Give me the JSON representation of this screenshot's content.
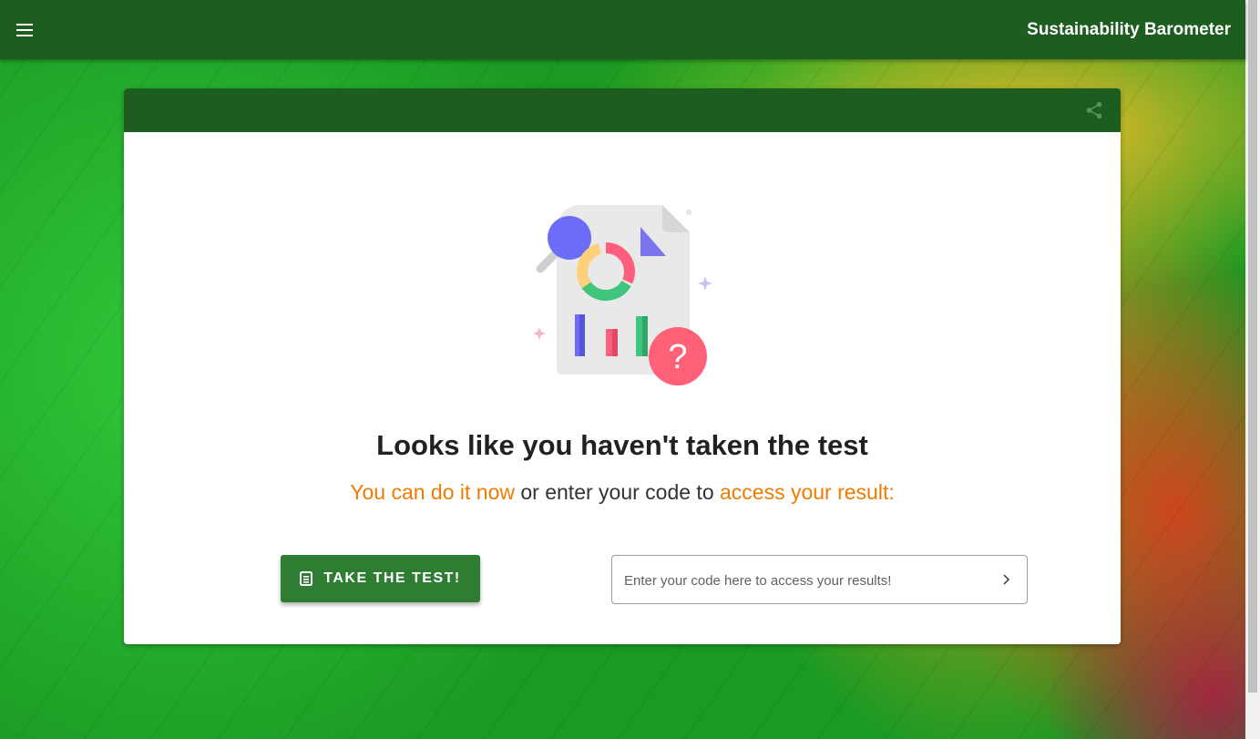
{
  "app": {
    "title": "Sustainability Barometer"
  },
  "icons": {
    "menu": "menu-icon",
    "share": "share-icon",
    "document": "document-icon",
    "chevron": "chevron-right-icon",
    "illustration": "report-question-illustration"
  },
  "main": {
    "headline": "Looks like you haven't taken the test",
    "subline": {
      "part1": "You can do it now",
      "part2": " or enter your code to ",
      "part3": "access your result:"
    },
    "take_test_label": "TAKE THE TEST!",
    "code_input": {
      "value": "",
      "placeholder": "Enter your code here to access your results!"
    }
  },
  "colors": {
    "primary": "#1d5e20",
    "button": "#2e7d32",
    "accent": "#ef7b00"
  }
}
